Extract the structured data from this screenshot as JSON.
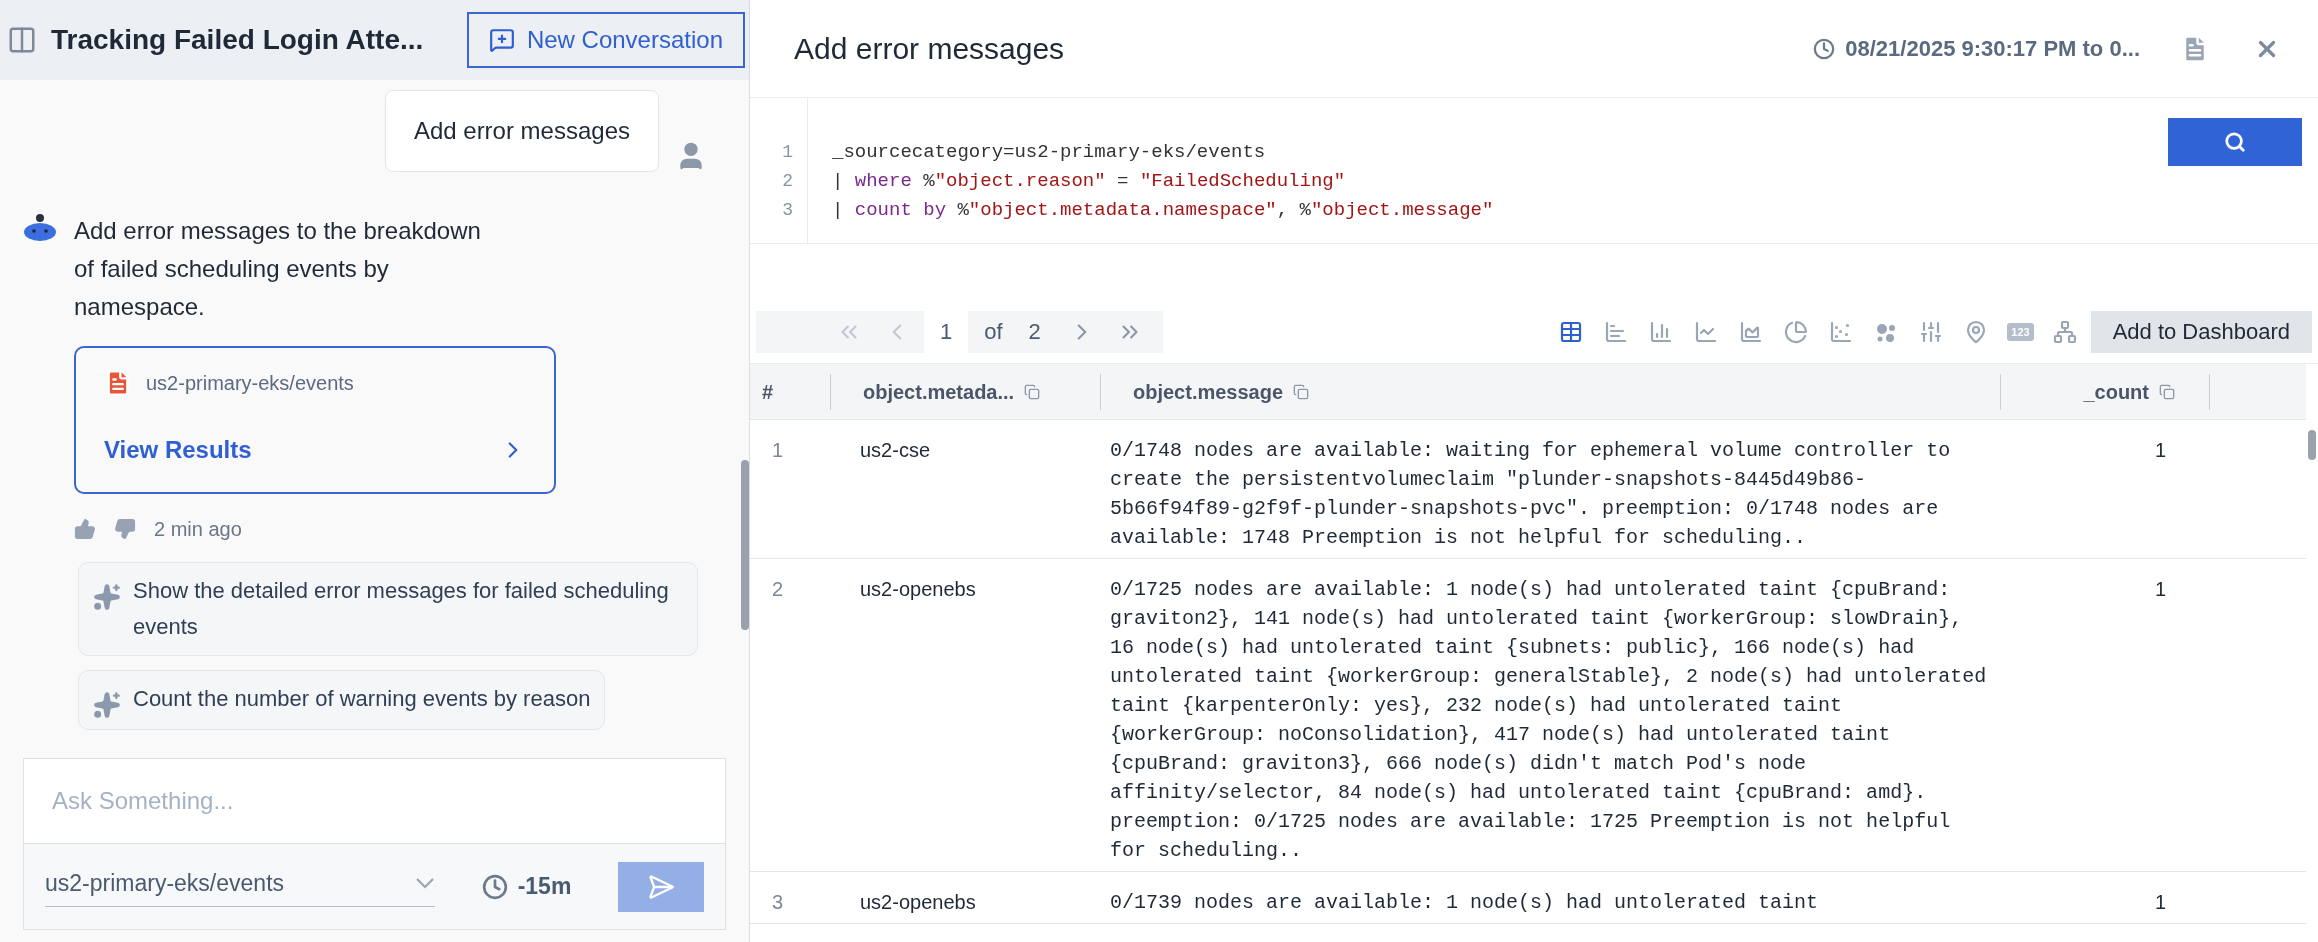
{
  "sidebar_header": {
    "title": "Tracking Failed Login Atte...",
    "new_button": "New Conversation"
  },
  "messages": [
    {
      "kind": "user",
      "text": "Add error messages"
    },
    {
      "kind": "assistant",
      "text": "Add error messages to the breakdown of failed scheduling events by namespace.",
      "result_card": {
        "source": "us2-primary-eks/events",
        "link": "View Results"
      },
      "time": "2 min ago"
    }
  ],
  "suggestions": [
    "Show the detailed error messages for failed scheduling events",
    "Count the number of warning events by reason"
  ],
  "composer": {
    "placeholder": "Ask Something...",
    "source": "us2-primary-eks/events",
    "time_range": "-15m"
  },
  "panel": {
    "title": "Add error messages",
    "time_range": "08/21/2025 9:30:17 PM to 0..."
  },
  "query": {
    "lines": [
      {
        "number": "1",
        "tokens": [
          {
            "kind": "plain",
            "text": "_sourcecategory=us2-primary-eks/events"
          }
        ]
      },
      {
        "number": "2",
        "tokens": [
          {
            "kind": "plain",
            "text": "| "
          },
          {
            "kind": "keyword",
            "text": "where"
          },
          {
            "kind": "plain",
            "text": " %"
          },
          {
            "kind": "string",
            "text": "\"object.reason\""
          },
          {
            "kind": "plain",
            "text": " = "
          },
          {
            "kind": "string",
            "text": "\"FailedScheduling\""
          }
        ]
      },
      {
        "number": "3",
        "tokens": [
          {
            "kind": "plain",
            "text": "| "
          },
          {
            "kind": "keyword",
            "text": "count by"
          },
          {
            "kind": "plain",
            "text": " %"
          },
          {
            "kind": "string",
            "text": "\"object.metadata.namespace\""
          },
          {
            "kind": "plain",
            "text": ", %"
          },
          {
            "kind": "string",
            "text": "\"object.message\""
          }
        ]
      }
    ]
  },
  "pagination": {
    "page": "1",
    "of": "of",
    "total": "2"
  },
  "chart_types": [
    {
      "kind": "table",
      "selected": true
    },
    {
      "kind": "bar",
      "selected": false
    },
    {
      "kind": "column",
      "selected": false
    },
    {
      "kind": "line",
      "selected": false
    },
    {
      "kind": "area",
      "selected": false
    },
    {
      "kind": "pie",
      "selected": false
    },
    {
      "kind": "scatter",
      "selected": false
    },
    {
      "kind": "bubble",
      "selected": false
    },
    {
      "kind": "sliders",
      "selected": false
    },
    {
      "kind": "map",
      "selected": false
    },
    {
      "kind": "number",
      "label": "123",
      "selected": false
    },
    {
      "kind": "tree",
      "selected": false
    }
  ],
  "add_button": "Add to Dashboard",
  "table": {
    "columns": [
      "#",
      "object.metada...",
      "object.message",
      "_count"
    ],
    "rows": [
      {
        "index": "1",
        "namespace": "us2-cse",
        "message": "0/1748 nodes are available: waiting for ephemeral volume controller to create the persistentvolumeclaim \"plunder-snapshots-8445d49b86-5b66f94f89-g2f9f-plunder-snapshots-pvc\". preemption: 0/1748 nodes are available: 1748 Preemption is not helpful for scheduling..",
        "count": "1"
      },
      {
        "index": "2",
        "namespace": "us2-openebs",
        "message": "0/1725 nodes are available: 1 node(s) had untolerated taint {cpuBrand: graviton2}, 141 node(s) had untolerated taint {workerGroup: slowDrain}, 16 node(s) had untolerated taint {subnets: public}, 166 node(s) had untolerated taint {workerGroup: generalStable}, 2 node(s) had untolerated taint {karpenterOnly: yes}, 232 node(s) had untolerated taint {workerGroup: noConsolidation}, 417 node(s) had untolerated taint {cpuBrand: graviton3}, 666 node(s) didn't match Pod's node affinity/selector, 84 node(s) had untolerated taint {cpuBrand: amd}. preemption: 0/1725 nodes are available: 1725 Preemption is not helpful for scheduling..",
        "count": "1"
      },
      {
        "index": "3",
        "namespace": "us2-openebs",
        "message": "0/1739 nodes are available: 1 node(s) had untolerated taint",
        "count": "1"
      }
    ]
  }
}
